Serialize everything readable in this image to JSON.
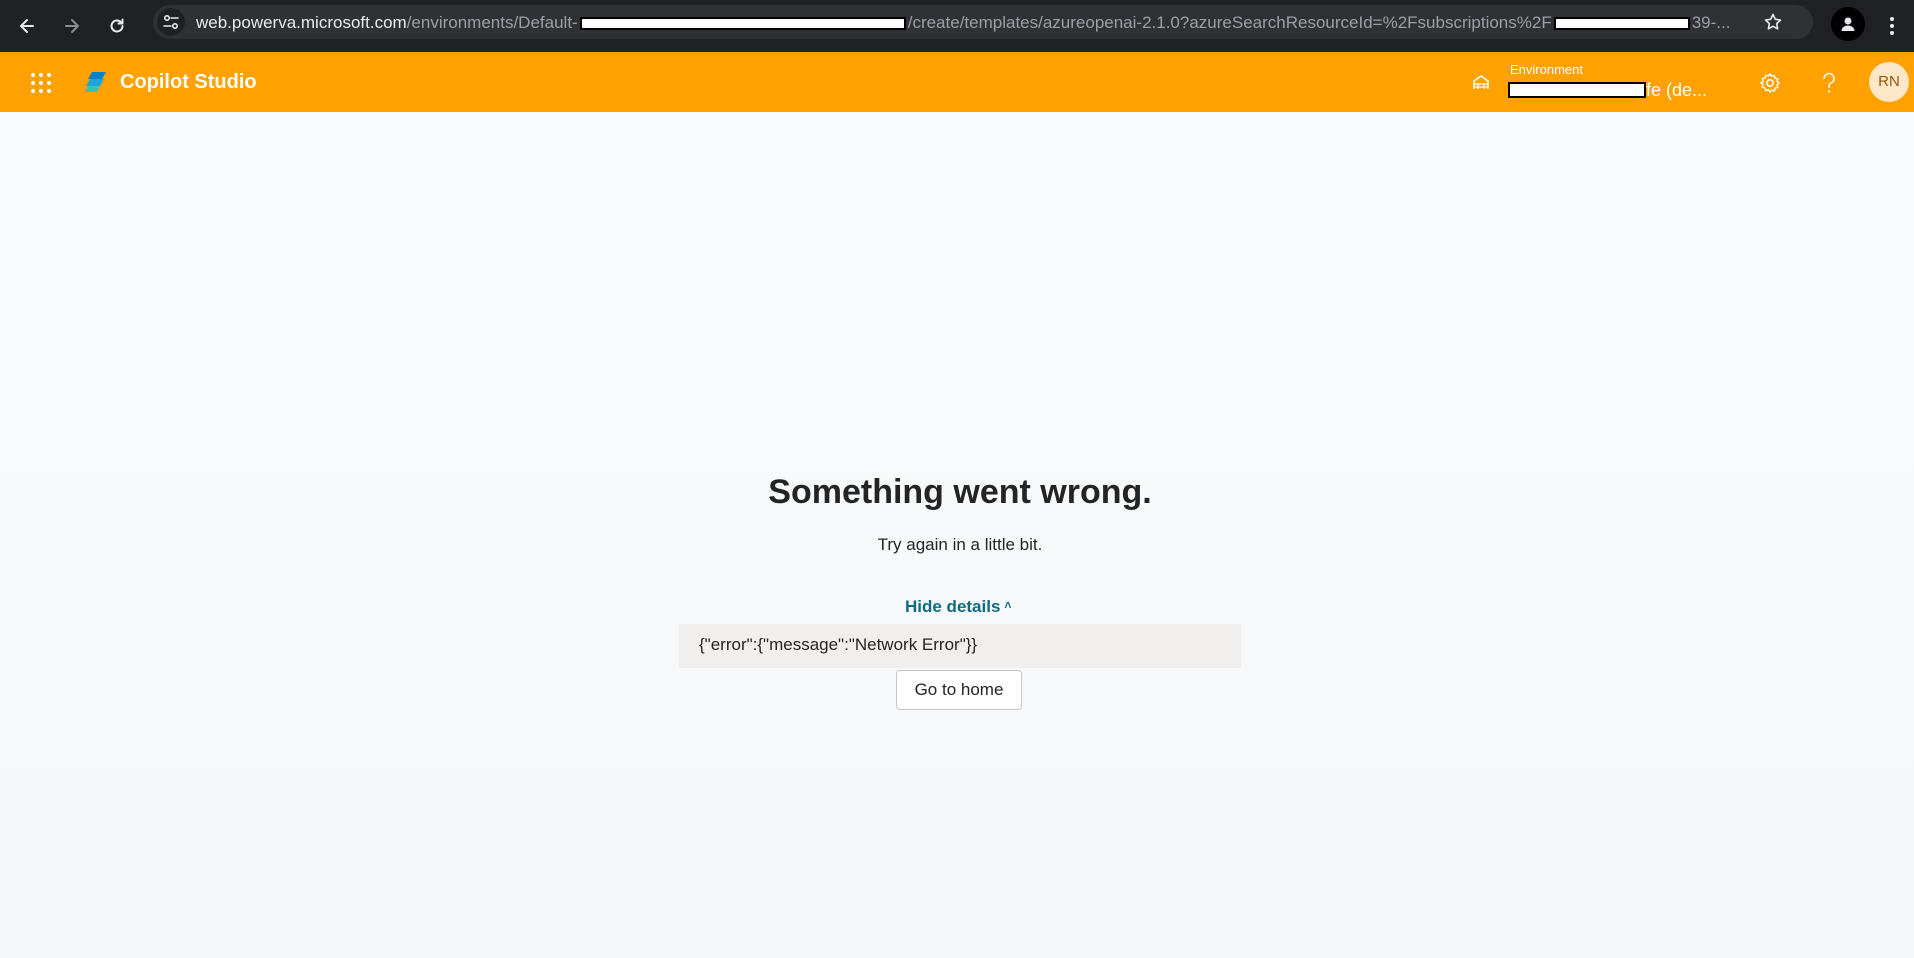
{
  "browser": {
    "url_host": "web.powerva.microsoft.com",
    "url_path_1": "/environments/Default-",
    "url_path_2": "/create/templates/azureopenai-2.1.0?azureSearchResourceId=%2Fsubscriptions%2F",
    "url_path_3": "39-..."
  },
  "header": {
    "app_name": "Copilot Studio",
    "environment_label": "Environment",
    "environment_value_suffix": "fe (de...",
    "avatar_initials": "RN",
    "brand_color": "#ffa100"
  },
  "error": {
    "title": "Something went wrong.",
    "subtitle": "Try again in a little bit.",
    "toggle_label": "Hide details",
    "details_text": "{\"error\":{\"message\":\"Network Error\"}}",
    "home_button_label": "Go to home"
  },
  "icons": {
    "back": "arrow-left-icon",
    "forward": "arrow-right-icon",
    "reload": "reload-icon",
    "site_info": "tune-icon",
    "star": "star-icon",
    "profile": "person-icon",
    "menu": "kebab-icon",
    "waffle": "app-launcher-icon",
    "environment": "environment-icon",
    "settings": "gear-icon",
    "help": "question-icon"
  }
}
